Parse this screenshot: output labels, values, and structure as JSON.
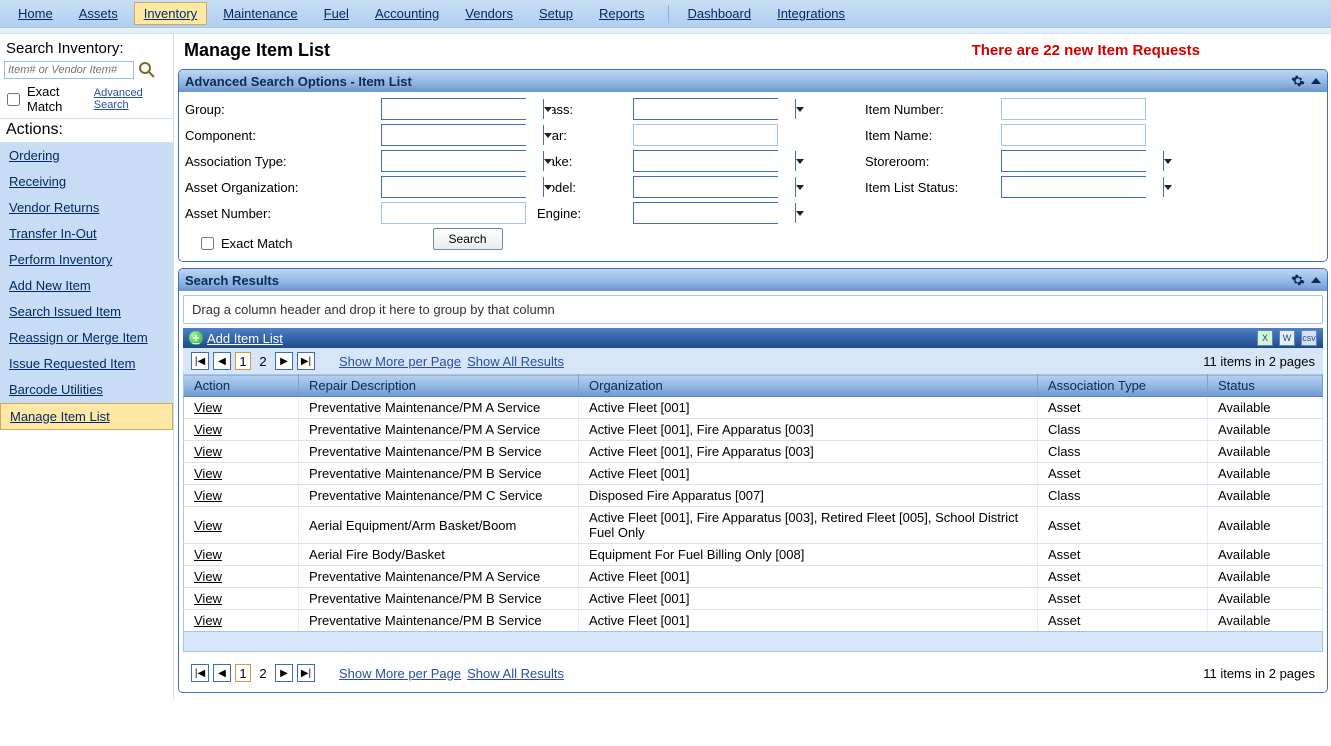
{
  "menu": {
    "items": [
      {
        "label": "Home"
      },
      {
        "label": "Assets"
      },
      {
        "label": "Inventory"
      },
      {
        "label": "Maintenance"
      },
      {
        "label": "Fuel"
      },
      {
        "label": "Accounting"
      },
      {
        "label": "Vendors"
      },
      {
        "label": "Setup"
      },
      {
        "label": "Reports"
      },
      {
        "label": "Dashboard"
      },
      {
        "label": "Integrations"
      }
    ],
    "active": "Inventory"
  },
  "sidebar": {
    "search_title": "Search Inventory:",
    "search_placeholder": "Item# or Vendor Item#",
    "exact_match_label": "Exact Match",
    "advanced_search_label": "Advanced Search",
    "actions_title": "Actions:",
    "actions": [
      {
        "label": "Ordering"
      },
      {
        "label": "Receiving"
      },
      {
        "label": "Vendor Returns"
      },
      {
        "label": "Transfer In-Out"
      },
      {
        "label": "Perform Inventory"
      },
      {
        "label": "Add New Item"
      },
      {
        "label": "Search Issued Item"
      },
      {
        "label": "Reassign or Merge Item"
      },
      {
        "label": "Issue Requested Item"
      },
      {
        "label": "Barcode Utilities"
      },
      {
        "label": "Manage Item List"
      }
    ],
    "active_action": "Manage Item List"
  },
  "main": {
    "title": "Manage Item List",
    "requests_notice": "There are 22 new Item Requests"
  },
  "adv_search": {
    "panel_title": "Advanced Search Options - Item List",
    "labels": {
      "group": "Group:",
      "component": "Component:",
      "assoc_type": "Association Type:",
      "asset_org": "Asset Organization:",
      "asset_num": "Asset Number:",
      "class": "Class:",
      "year": "Year:",
      "make": "Make:",
      "model": "Model:",
      "engine": "Engine:",
      "item_number": "Item Number:",
      "item_name": "Item Name:",
      "storeroom": "Storeroom:",
      "item_list_status": "Item List Status:",
      "exact_match": "Exact Match",
      "search_btn": "Search"
    }
  },
  "results": {
    "panel_title": "Search Results",
    "group_hint": "Drag a column header and drop it here to group by that column",
    "add_item_list_label": "Add Item List",
    "show_more_label": "Show More per Page",
    "show_all_label": "Show All Results",
    "count_text": "11 items in 2 pages",
    "pages": {
      "current": "1",
      "other": "2"
    },
    "columns": [
      "Action",
      "Repair Description",
      "Organization",
      "Association Type",
      "Status"
    ],
    "view_label": "View",
    "rows": [
      {
        "repair": "Preventative Maintenance/PM A Service",
        "org": "Active Fleet [001]",
        "assoc": "Asset",
        "status": "Available"
      },
      {
        "repair": "Preventative Maintenance/PM A Service",
        "org": "Active Fleet [001], Fire Apparatus [003]",
        "assoc": "Class",
        "status": "Available"
      },
      {
        "repair": "Preventative Maintenance/PM B Service",
        "org": "Active Fleet [001], Fire Apparatus [003]",
        "assoc": "Class",
        "status": "Available"
      },
      {
        "repair": "Preventative Maintenance/PM B Service",
        "org": "Active Fleet [001]",
        "assoc": "Asset",
        "status": "Available"
      },
      {
        "repair": "Preventative Maintenance/PM C Service",
        "org": "Disposed Fire Apparatus [007]",
        "assoc": "Class",
        "status": "Available"
      },
      {
        "repair": "Aerial Equipment/Arm Basket/Boom",
        "org": "Active Fleet [001], Fire Apparatus [003], Retired Fleet [005], School District Fuel Only",
        "assoc": "Asset",
        "status": "Available"
      },
      {
        "repair": "Aerial Fire Body/Basket",
        "org": "Equipment For Fuel Billing Only [008]",
        "assoc": "Asset",
        "status": "Available"
      },
      {
        "repair": "Preventative Maintenance/PM A Service",
        "org": "Active Fleet [001]",
        "assoc": "Asset",
        "status": "Available"
      },
      {
        "repair": "Preventative Maintenance/PM B Service",
        "org": "Active Fleet [001]",
        "assoc": "Asset",
        "status": "Available"
      },
      {
        "repair": "Preventative Maintenance/PM B Service",
        "org": "Active Fleet [001]",
        "assoc": "Asset",
        "status": "Available"
      }
    ]
  }
}
